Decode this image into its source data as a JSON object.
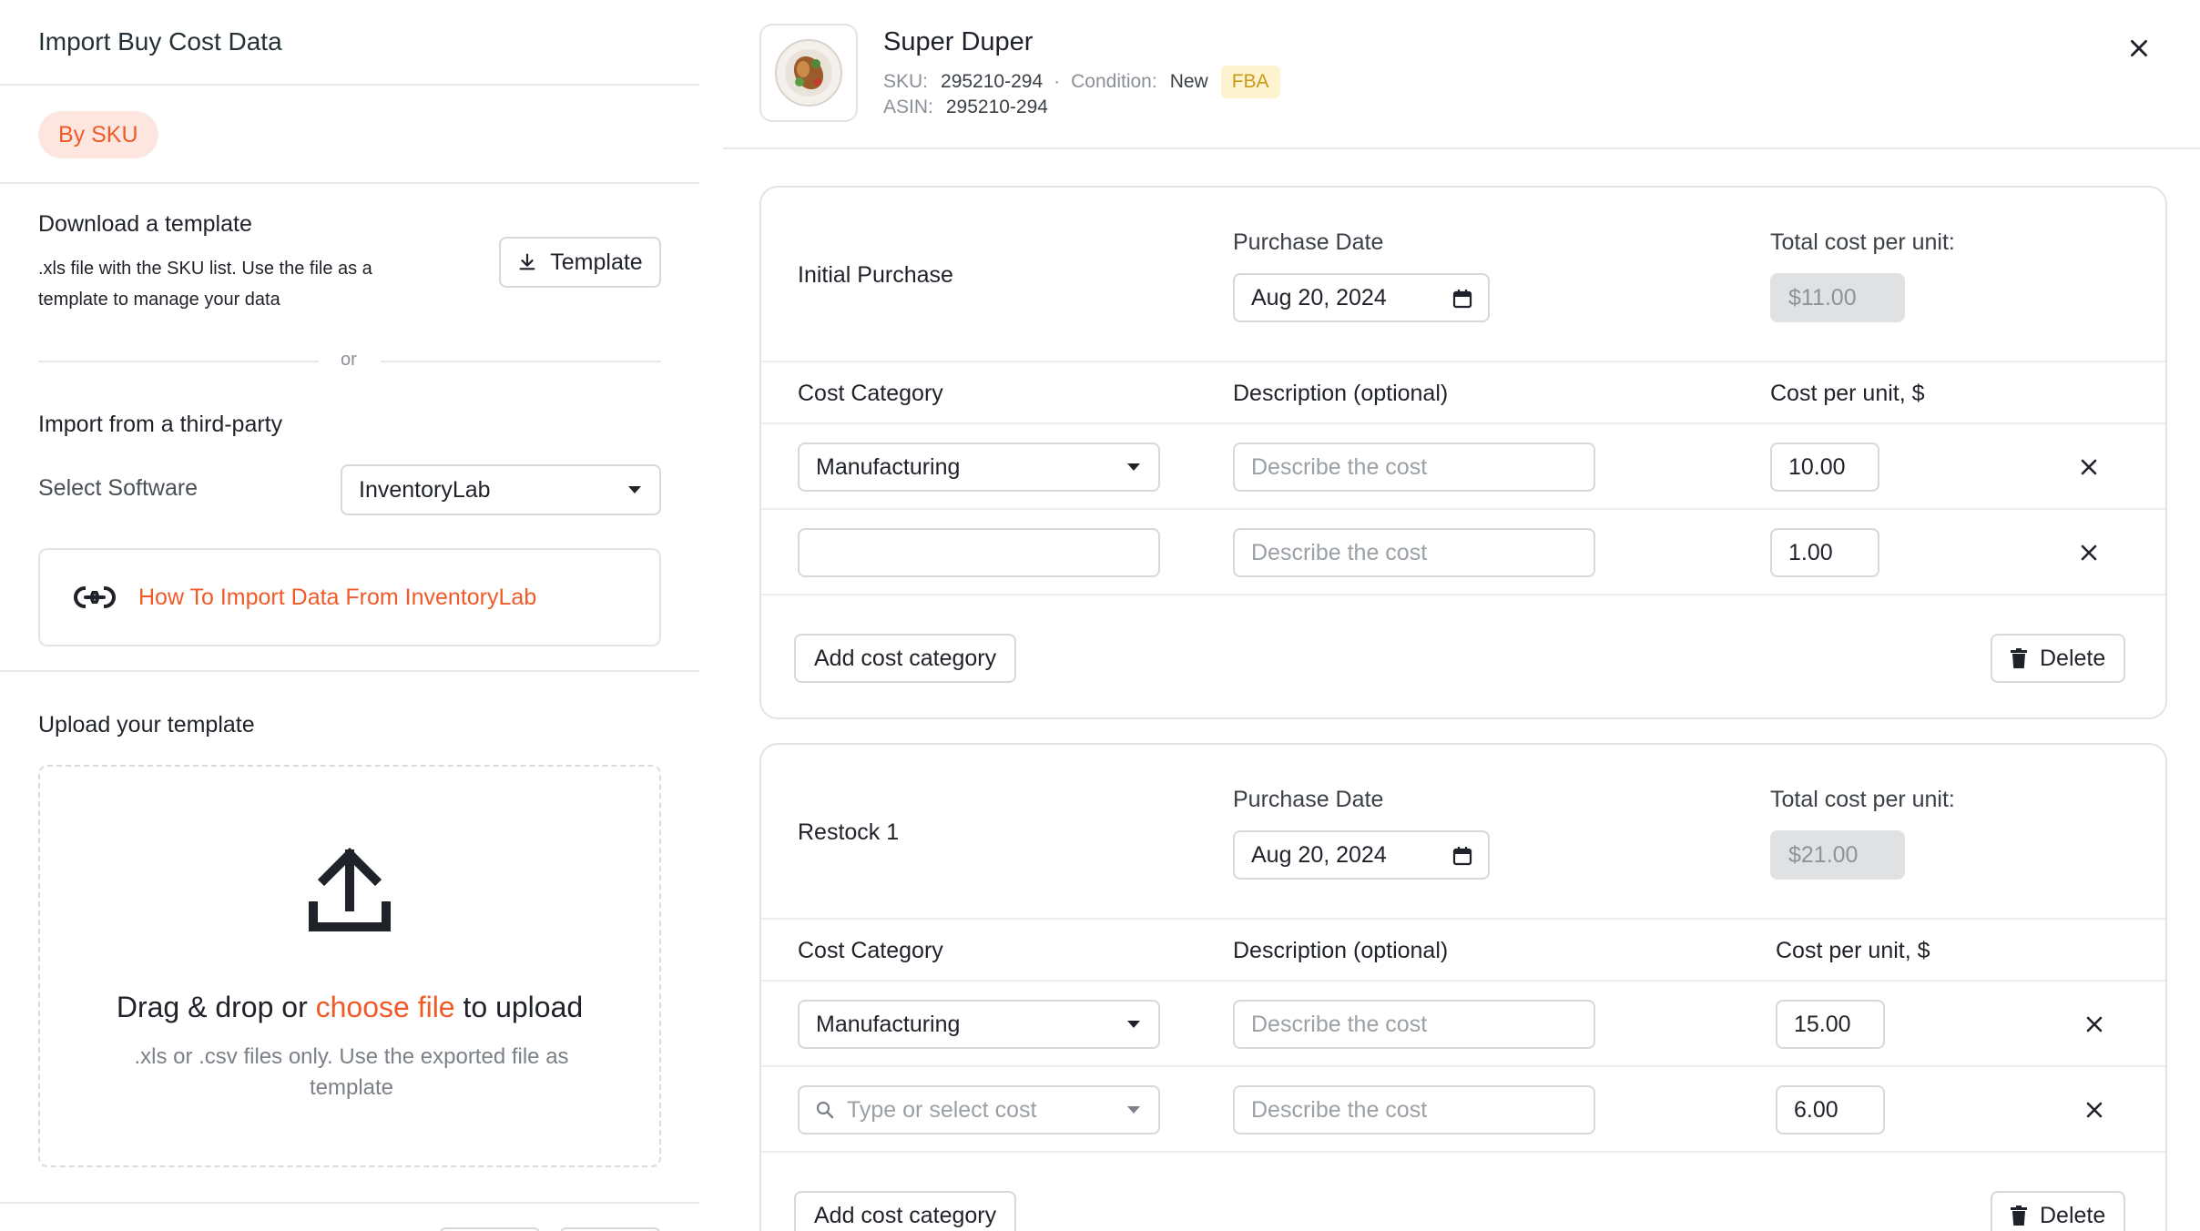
{
  "left": {
    "title": "Import Buy Cost Data",
    "tab_by_sku": "By SKU",
    "download_title": "Download a template",
    "download_hint": ".xls file with the SKU list. Use the file as a template to manage your data",
    "template_button": "Template",
    "or_label": "or",
    "third_party_title": "Import from a third-party",
    "select_software_label": "Select Software",
    "software_value": "InventoryLab",
    "how_to_link": "How To Import Data From InventoryLab",
    "upload_title": "Upload your template",
    "drop_prefix": "Drag & drop or ",
    "drop_link": "choose file",
    "drop_suffix": " to upload",
    "drop_hint": ".xls or .csv files only. Use the exported file as template"
  },
  "product": {
    "name": "Super Duper",
    "sku_label": "SKU:",
    "sku": "295210-294",
    "condition_label": "Condition:",
    "condition": "New",
    "badge": "FBA",
    "asin_label": "ASIN:",
    "asin": "295210-294"
  },
  "purchases": [
    {
      "title": "Initial Purchase",
      "date_label": "Purchase Date",
      "date": "Aug 20, 2024",
      "total_label": "Total cost per unit:",
      "total": "$11.00",
      "col_category": "Cost Category",
      "col_description": "Description (optional)",
      "col_cost": "Cost per unit, $",
      "rows": [
        {
          "category": "Manufacturing",
          "description_placeholder": "Describe the cost",
          "cost": "10.00"
        },
        {
          "category": "",
          "description_placeholder": "Describe the cost",
          "cost": "1.00"
        }
      ],
      "add_label": "Add cost category",
      "delete_label": "Delete"
    },
    {
      "title": "Restock 1",
      "date_label": "Purchase Date",
      "date": "Aug 20, 2024",
      "total_label": "Total cost per unit:",
      "total": "$21.00",
      "col_category": "Cost Category",
      "col_description": "Description (optional)",
      "col_cost": "Cost per unit, $",
      "rows": [
        {
          "category": "Manufacturing",
          "description_placeholder": "Describe the cost",
          "cost": "15.00"
        },
        {
          "category_placeholder": "Type or select cost",
          "description_placeholder": "Describe the cost",
          "cost": "6.00"
        }
      ],
      "add_label": "Add cost category",
      "delete_label": "Delete"
    }
  ],
  "colors": {
    "accent": "#f05a28",
    "accent_bg": "#fde6df",
    "badge_bg": "#fdf3cf",
    "badge_text": "#c89a1a",
    "border": "#d6d9dc",
    "disabled_bg": "#dfe1e3"
  },
  "icons": [
    "download-icon",
    "link-icon",
    "upload-icon",
    "close-icon",
    "calendar-icon",
    "chevron-down-icon",
    "search-icon",
    "trash-icon",
    "remove-row-icon",
    "product-thumbnail"
  ]
}
